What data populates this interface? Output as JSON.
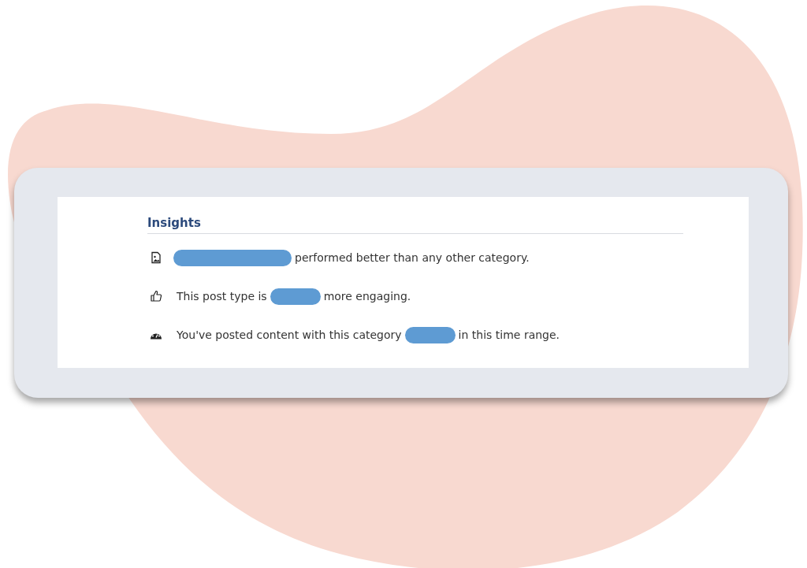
{
  "panel": {
    "title": "Insights",
    "insights": [
      {
        "kind": "image",
        "segments": [
          {
            "kind": "longbar"
          },
          {
            "kind": "text",
            "text": "performed better than any other category."
          }
        ]
      },
      {
        "kind": "thumb",
        "segments": [
          {
            "kind": "text",
            "text": "This post type is"
          },
          {
            "kind": "bar"
          },
          {
            "kind": "text",
            "text": "more engaging."
          }
        ]
      },
      {
        "kind": "gauge",
        "segments": [
          {
            "kind": "text",
            "text": "You've posted content with this category"
          },
          {
            "kind": "bar"
          },
          {
            "kind": "text",
            "text": "in this time range."
          }
        ]
      }
    ]
  }
}
